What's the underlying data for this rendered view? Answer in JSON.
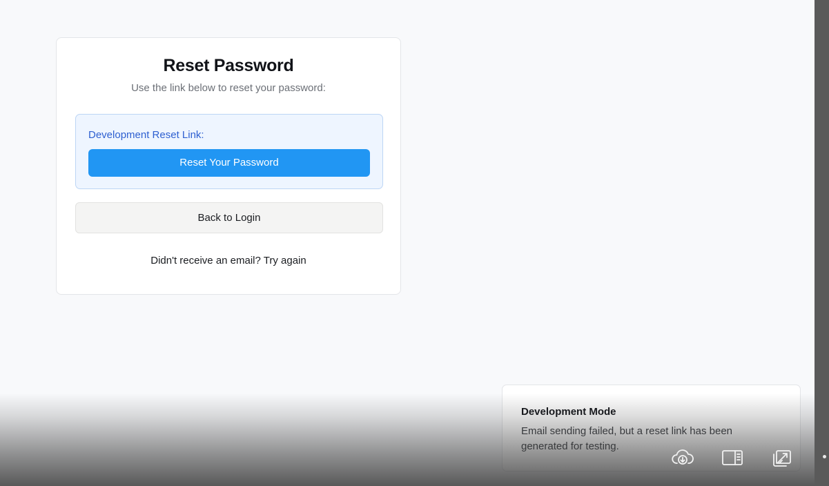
{
  "card": {
    "title": "Reset Password",
    "subtitle": "Use the link below to reset your password:",
    "dev_label": "Development Reset Link:",
    "reset_button": "Reset Your Password",
    "back_button": "Back to Login",
    "retry_prompt": "Didn't receive an email?",
    "retry_link": "Try again"
  },
  "toast": {
    "title": "Development Mode",
    "message": "Email sending failed, but a reset link has been generated for testing."
  },
  "toolbar": {
    "icons": [
      "cloud-download-icon",
      "sidebar-panel-icon",
      "open-external-icon"
    ]
  },
  "colors": {
    "page_bg": "#f8f9fb",
    "accent": "#2196f3",
    "dev_box_bg": "#eef5ff",
    "dev_label": "#2d5fd0"
  }
}
